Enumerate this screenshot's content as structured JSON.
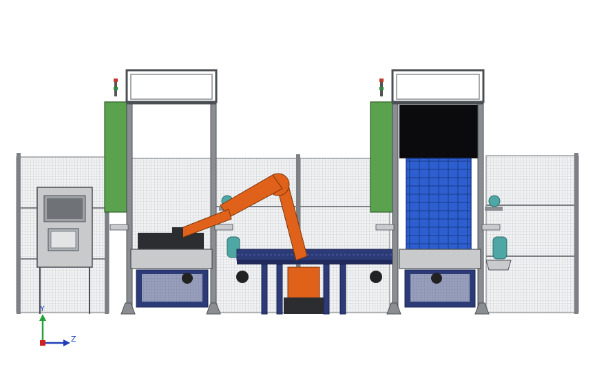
{
  "axis_triad": {
    "vertical_label": "Y",
    "horizontal_label": "Z"
  },
  "colors": {
    "background": "#ffffff",
    "frame_steel": "#8a8e92",
    "frame_dark": "#4b4f53",
    "fence_mesh": "#c9ccd0",
    "control_cabinet": "#5aa24d",
    "robot_orange": "#e0621a",
    "conveyor_navy": "#2c3a78",
    "pallet_blue": "#2e5fd0",
    "hmi_panel": "#c8cacc",
    "pump_teal": "#4fa7a5",
    "axis_y": "#23a23a",
    "axis_z": "#1f3fb8",
    "axis_origin": "#d42020"
  },
  "components": {
    "left_cell": "left-palletizing-frame",
    "right_cell": "right-pallet-magazine",
    "robot": "industrial-robot-arm",
    "conveyor": "center-roller-conveyor",
    "operator_panel": "hmi-operator-panel",
    "safety_fence": "wire-mesh-safety-fence"
  }
}
